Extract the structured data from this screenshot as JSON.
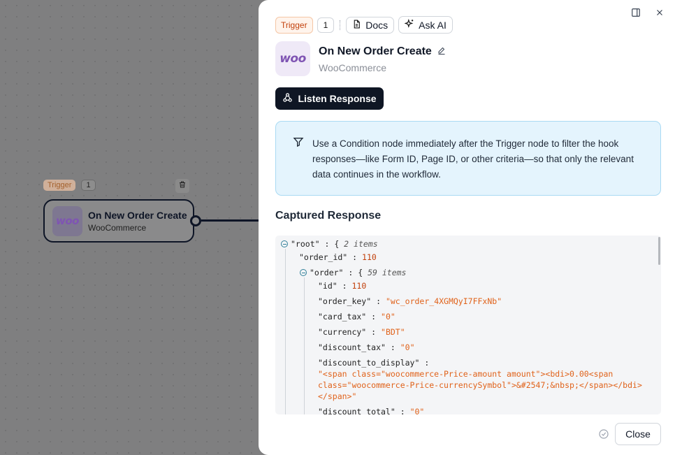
{
  "canvas": {
    "node": {
      "trigger_label": "Trigger",
      "count": "1",
      "title": "On New Order Create",
      "subtitle": "WooCommerce",
      "logo_text": "woo"
    }
  },
  "panel": {
    "badges": {
      "trigger": "Trigger",
      "count": "1"
    },
    "docs_label": "Docs",
    "ask_ai_label": "Ask AI",
    "logo_text": "woo",
    "title": "On New Order Create",
    "subtitle": "WooCommerce",
    "listen_button": "Listen Response",
    "info_text": "Use a Condition node immediately after the Trigger node to filter the hook responses—like Form ID, Page ID, or other criteria—so that only the relevant data continues in the workflow.",
    "captured_title": "Captured Response",
    "close_button": "Close",
    "icons": [
      "sidebar-toggle-icon",
      "close-icon",
      "document-icon",
      "sparkle-icon",
      "pencil-icon",
      "webhook-icon",
      "filter-icon",
      "check-circle-icon",
      "trash-icon"
    ]
  },
  "json_view": {
    "root_key": "\"root\"",
    "root_count": "2 items",
    "order_id_key": "\"order_id\"",
    "order_id_val": "110",
    "order_key": "\"order\"",
    "order_count": "59 items",
    "rows": [
      {
        "key": "\"id\"",
        "val": "110",
        "type": "num"
      },
      {
        "key": "\"order_key\"",
        "val": "\"wc_order_4XGMQyI7FFxNb\"",
        "type": "str"
      },
      {
        "key": "\"card_tax\"",
        "val": "\"0\"",
        "type": "str"
      },
      {
        "key": "\"currency\"",
        "val": "\"BDT\"",
        "type": "str"
      },
      {
        "key": "\"discount_tax\"",
        "val": "\"0\"",
        "type": "str"
      }
    ],
    "display_key": "\"discount_to_display\"",
    "display_val_1": "\"<span class=\"woocommerce-Price-amount amount\"><bdi>0.00<span",
    "display_val_2": "class=\"woocommerce-Price-currencySymbol\">&#2547;&nbsp;</span></bdi>",
    "display_val_3": "</span>\"",
    "discount_total_key": "\"discount_total\"",
    "discount_total_val": "\"0\""
  }
}
